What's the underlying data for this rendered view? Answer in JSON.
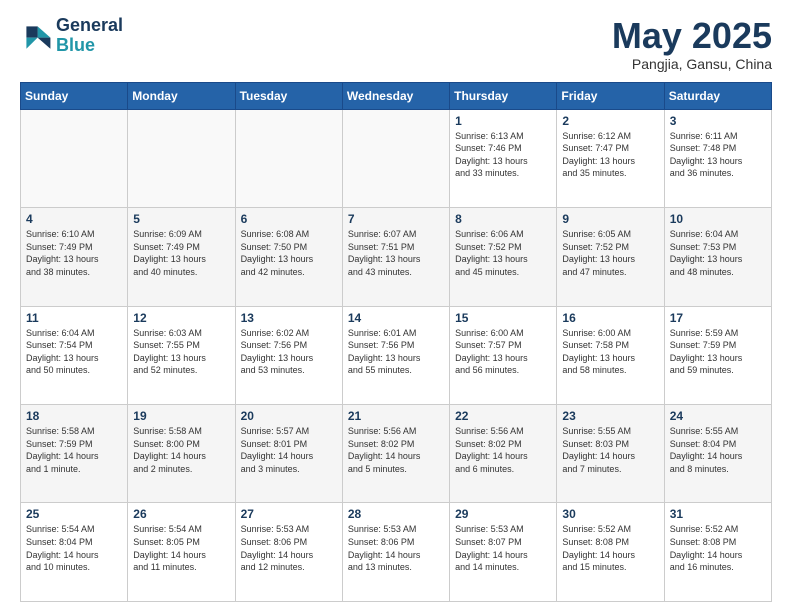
{
  "header": {
    "logo_line1": "General",
    "logo_line2": "Blue",
    "month_title": "May 2025",
    "subtitle": "Pangjia, Gansu, China"
  },
  "weekdays": [
    "Sunday",
    "Monday",
    "Tuesday",
    "Wednesday",
    "Thursday",
    "Friday",
    "Saturday"
  ],
  "weeks": [
    [
      {
        "day": "",
        "info": ""
      },
      {
        "day": "",
        "info": ""
      },
      {
        "day": "",
        "info": ""
      },
      {
        "day": "",
        "info": ""
      },
      {
        "day": "1",
        "info": "Sunrise: 6:13 AM\nSunset: 7:46 PM\nDaylight: 13 hours\nand 33 minutes."
      },
      {
        "day": "2",
        "info": "Sunrise: 6:12 AM\nSunset: 7:47 PM\nDaylight: 13 hours\nand 35 minutes."
      },
      {
        "day": "3",
        "info": "Sunrise: 6:11 AM\nSunset: 7:48 PM\nDaylight: 13 hours\nand 36 minutes."
      }
    ],
    [
      {
        "day": "4",
        "info": "Sunrise: 6:10 AM\nSunset: 7:49 PM\nDaylight: 13 hours\nand 38 minutes."
      },
      {
        "day": "5",
        "info": "Sunrise: 6:09 AM\nSunset: 7:49 PM\nDaylight: 13 hours\nand 40 minutes."
      },
      {
        "day": "6",
        "info": "Sunrise: 6:08 AM\nSunset: 7:50 PM\nDaylight: 13 hours\nand 42 minutes."
      },
      {
        "day": "7",
        "info": "Sunrise: 6:07 AM\nSunset: 7:51 PM\nDaylight: 13 hours\nand 43 minutes."
      },
      {
        "day": "8",
        "info": "Sunrise: 6:06 AM\nSunset: 7:52 PM\nDaylight: 13 hours\nand 45 minutes."
      },
      {
        "day": "9",
        "info": "Sunrise: 6:05 AM\nSunset: 7:52 PM\nDaylight: 13 hours\nand 47 minutes."
      },
      {
        "day": "10",
        "info": "Sunrise: 6:04 AM\nSunset: 7:53 PM\nDaylight: 13 hours\nand 48 minutes."
      }
    ],
    [
      {
        "day": "11",
        "info": "Sunrise: 6:04 AM\nSunset: 7:54 PM\nDaylight: 13 hours\nand 50 minutes."
      },
      {
        "day": "12",
        "info": "Sunrise: 6:03 AM\nSunset: 7:55 PM\nDaylight: 13 hours\nand 52 minutes."
      },
      {
        "day": "13",
        "info": "Sunrise: 6:02 AM\nSunset: 7:56 PM\nDaylight: 13 hours\nand 53 minutes."
      },
      {
        "day": "14",
        "info": "Sunrise: 6:01 AM\nSunset: 7:56 PM\nDaylight: 13 hours\nand 55 minutes."
      },
      {
        "day": "15",
        "info": "Sunrise: 6:00 AM\nSunset: 7:57 PM\nDaylight: 13 hours\nand 56 minutes."
      },
      {
        "day": "16",
        "info": "Sunrise: 6:00 AM\nSunset: 7:58 PM\nDaylight: 13 hours\nand 58 minutes."
      },
      {
        "day": "17",
        "info": "Sunrise: 5:59 AM\nSunset: 7:59 PM\nDaylight: 13 hours\nand 59 minutes."
      }
    ],
    [
      {
        "day": "18",
        "info": "Sunrise: 5:58 AM\nSunset: 7:59 PM\nDaylight: 14 hours\nand 1 minute."
      },
      {
        "day": "19",
        "info": "Sunrise: 5:58 AM\nSunset: 8:00 PM\nDaylight: 14 hours\nand 2 minutes."
      },
      {
        "day": "20",
        "info": "Sunrise: 5:57 AM\nSunset: 8:01 PM\nDaylight: 14 hours\nand 3 minutes."
      },
      {
        "day": "21",
        "info": "Sunrise: 5:56 AM\nSunset: 8:02 PM\nDaylight: 14 hours\nand 5 minutes."
      },
      {
        "day": "22",
        "info": "Sunrise: 5:56 AM\nSunset: 8:02 PM\nDaylight: 14 hours\nand 6 minutes."
      },
      {
        "day": "23",
        "info": "Sunrise: 5:55 AM\nSunset: 8:03 PM\nDaylight: 14 hours\nand 7 minutes."
      },
      {
        "day": "24",
        "info": "Sunrise: 5:55 AM\nSunset: 8:04 PM\nDaylight: 14 hours\nand 8 minutes."
      }
    ],
    [
      {
        "day": "25",
        "info": "Sunrise: 5:54 AM\nSunset: 8:04 PM\nDaylight: 14 hours\nand 10 minutes."
      },
      {
        "day": "26",
        "info": "Sunrise: 5:54 AM\nSunset: 8:05 PM\nDaylight: 14 hours\nand 11 minutes."
      },
      {
        "day": "27",
        "info": "Sunrise: 5:53 AM\nSunset: 8:06 PM\nDaylight: 14 hours\nand 12 minutes."
      },
      {
        "day": "28",
        "info": "Sunrise: 5:53 AM\nSunset: 8:06 PM\nDaylight: 14 hours\nand 13 minutes."
      },
      {
        "day": "29",
        "info": "Sunrise: 5:53 AM\nSunset: 8:07 PM\nDaylight: 14 hours\nand 14 minutes."
      },
      {
        "day": "30",
        "info": "Sunrise: 5:52 AM\nSunset: 8:08 PM\nDaylight: 14 hours\nand 15 minutes."
      },
      {
        "day": "31",
        "info": "Sunrise: 5:52 AM\nSunset: 8:08 PM\nDaylight: 14 hours\nand 16 minutes."
      }
    ]
  ]
}
